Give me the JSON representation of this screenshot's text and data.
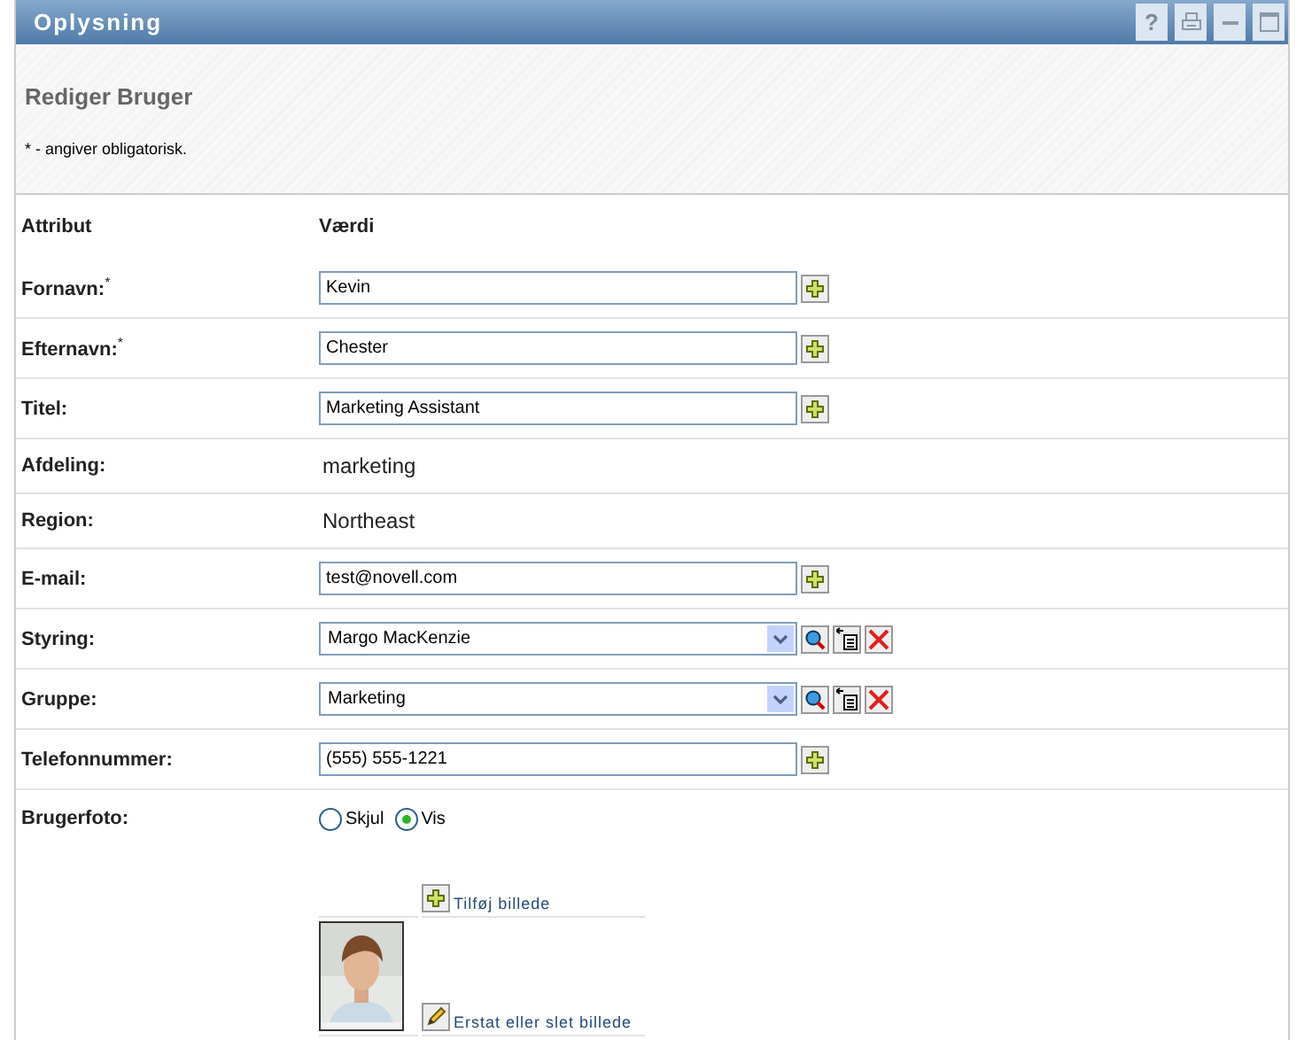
{
  "window": {
    "title": "Oplysning",
    "help": "?"
  },
  "header": {
    "title": "Rediger Bruger",
    "note": "* - angiver obligatorisk."
  },
  "table": {
    "columns": [
      "Attribut",
      "Værdi"
    ],
    "rows": [
      {
        "kind": "input",
        "label": "Fornavn:",
        "marker": "*",
        "value": "Kevin"
      },
      {
        "kind": "input",
        "label": "Efternavn:",
        "marker": "*",
        "value": "Chester"
      },
      {
        "kind": "input",
        "label": "Titel:",
        "value": "Marketing Assistant"
      },
      {
        "kind": "text",
        "label": "Afdeling:",
        "value": "marketing"
      },
      {
        "kind": "text",
        "label": "Region:",
        "value": "Northeast"
      },
      {
        "kind": "input",
        "label": "E-mail:",
        "value": "test@novell.com"
      },
      {
        "kind": "select",
        "label": "Styring:",
        "value": "Margo MacKenzie"
      },
      {
        "kind": "select",
        "label": "Gruppe:",
        "value": "Marketing"
      },
      {
        "kind": "input",
        "label": "Telefonnummer:",
        "value": "(555) 555-1221"
      },
      {
        "label": "Brugerfoto:",
        "options": [
          {
            "label": "Skjul",
            "selected": false
          },
          {
            "label": "Vis",
            "selected": true
          }
        ],
        "add_link": "Tilføj billede",
        "replace_link": "Erstat eller slet billede"
      }
    ]
  }
}
